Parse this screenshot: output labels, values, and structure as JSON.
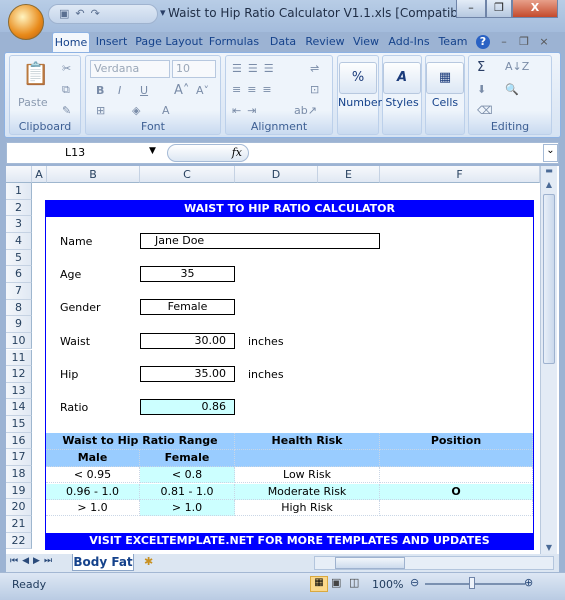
{
  "window": {
    "title": "Waist to Hip Ratio Calculator V1.1.xls  [Compatibili...",
    "minimize": "–",
    "restore": "❐",
    "close": "X"
  },
  "ribbon_tabs": [
    "Home",
    "Insert",
    "Page Layout",
    "Formulas",
    "Data",
    "Review",
    "View",
    "Add-Ins",
    "Team"
  ],
  "ribbon": {
    "clipboard": {
      "label": "Clipboard",
      "paste": "Paste"
    },
    "font": {
      "label": "Font",
      "font_name": "Verdana",
      "font_size": "10",
      "bold": "B",
      "italic": "I",
      "underline": "U"
    },
    "alignment": {
      "label": "Alignment"
    },
    "number": {
      "label": "Number",
      "icon": "%"
    },
    "styles": {
      "label": "Styles",
      "icon": "A"
    },
    "cells": {
      "label": "Cells"
    },
    "editing": {
      "label": "Editing",
      "sum": "Σ"
    }
  },
  "formula_bar": {
    "name_box": "L13",
    "fx": "fx",
    "formula": ""
  },
  "columns": [
    "A",
    "B",
    "C",
    "D",
    "E",
    "F"
  ],
  "rows": [
    "1",
    "2",
    "3",
    "4",
    "5",
    "6",
    "7",
    "8",
    "9",
    "10",
    "11",
    "12",
    "13",
    "14",
    "15",
    "16",
    "17",
    "18",
    "19",
    "20",
    "21",
    "22"
  ],
  "calculator": {
    "title": "WAIST TO HIP RATIO CALCULATOR",
    "name_label": "Name",
    "name_value": "Jane Doe",
    "age_label": "Age",
    "age_value": "35",
    "gender_label": "Gender",
    "gender_value": "Female",
    "waist_label": "Waist",
    "waist_value": "30.00",
    "waist_unit": "inches",
    "hip_label": "Hip",
    "hip_value": "35.00",
    "hip_unit": "inches",
    "ratio_label": "Ratio",
    "ratio_value": "0.86"
  },
  "table": {
    "header_range": "Waist to Hip Ratio Range",
    "header_risk": "Health Risk",
    "header_position": "Position",
    "sub_male": "Male",
    "sub_female": "Female",
    "rows": [
      {
        "male": "< 0.95",
        "female": "< 0.8",
        "risk": "Low Risk",
        "position": ""
      },
      {
        "male": "0.96 - 1.0",
        "female": "0.81 - 1.0",
        "risk": "Moderate Risk",
        "position": "O"
      },
      {
        "male": "> 1.0",
        "female": "> 1.0",
        "risk": "High Risk",
        "position": ""
      }
    ]
  },
  "footer_banner": "VISIT EXCELTEMPLATE.NET  FOR MORE TEMPLATES AND UPDATES",
  "sheet_tabs": [
    "Body Fat"
  ],
  "status": {
    "text": "Ready",
    "zoom": "100%"
  },
  "colors": {
    "banner": "#0000ff",
    "header": "#99ccff",
    "highlight": "#ccffff"
  }
}
